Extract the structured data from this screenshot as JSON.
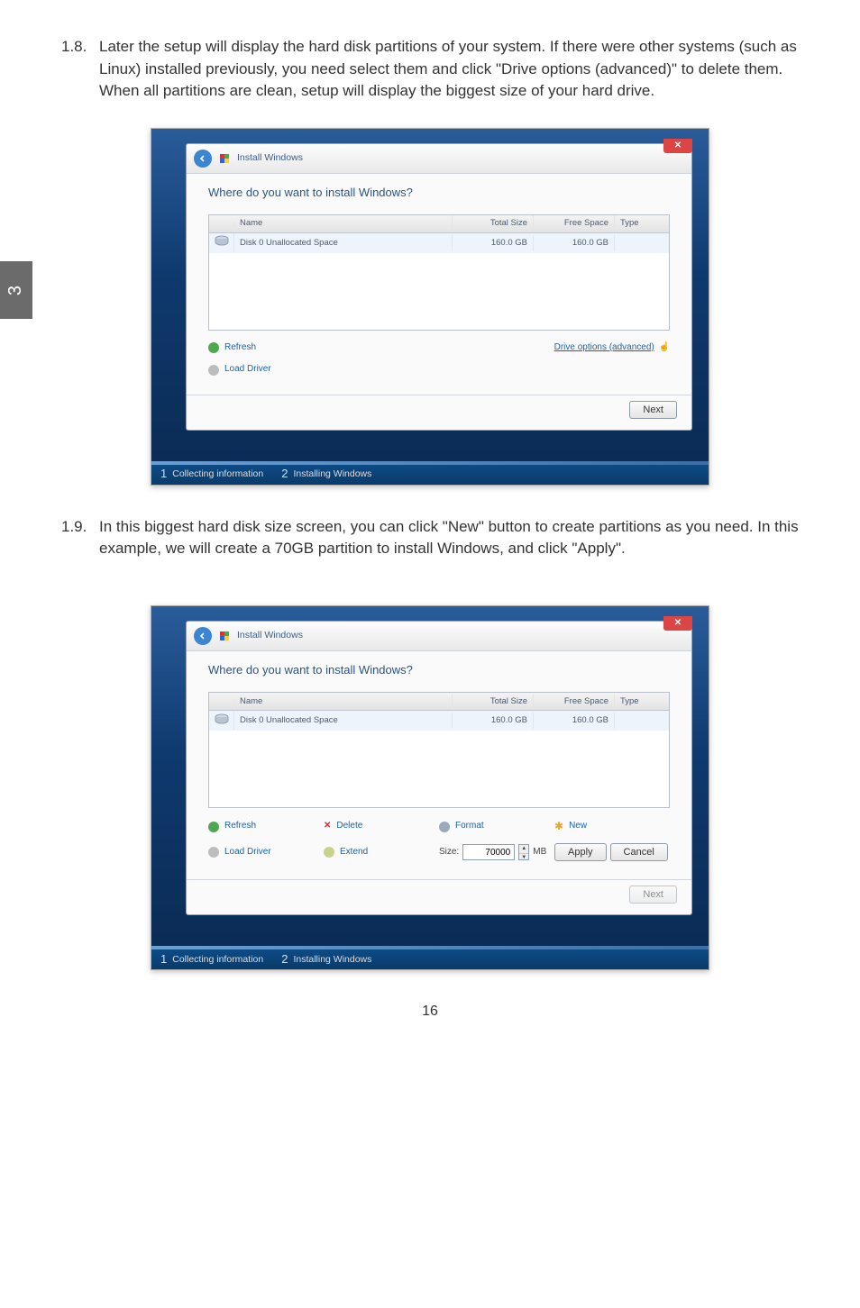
{
  "page_tab": "3",
  "page_number": "16",
  "para_1_8": {
    "num": "1.8.",
    "text": "Later the setup will display the hard disk partitions of your system. If there were other systems (such as Linux) installed previously, you need select them and click \"Drive options (advanced)\" to delete them. When all partitions are clean, setup will display the biggest size of your hard drive."
  },
  "para_1_9": {
    "num": "1.9.",
    "text": "In this biggest hard disk size screen, you can click \"New\" button to create partitions as you need. In this example, we will create a 70GB partition to install Windows, and click \"Apply\"."
  },
  "dialog": {
    "title": "Install Windows",
    "heading": "Where do you want to install Windows?",
    "headers": {
      "name": "Name",
      "total_size": "Total Size",
      "free_space": "Free Space",
      "type": "Type"
    },
    "row": {
      "name": "Disk 0 Unallocated Space",
      "total_size": "160.0 GB",
      "free_space": "160.0 GB",
      "type": ""
    },
    "refresh": "Refresh",
    "load_driver": "Load Driver",
    "drive_options": "Drive options (advanced)",
    "delete": "Delete",
    "format": "Format",
    "new": "New",
    "extend": "Extend",
    "size_label": "Size:",
    "size_value": "70000",
    "size_unit": "MB",
    "apply": "Apply",
    "cancel": "Cancel",
    "next": "Next"
  },
  "steps": {
    "s1": "Collecting information",
    "s2": "Installing Windows"
  }
}
